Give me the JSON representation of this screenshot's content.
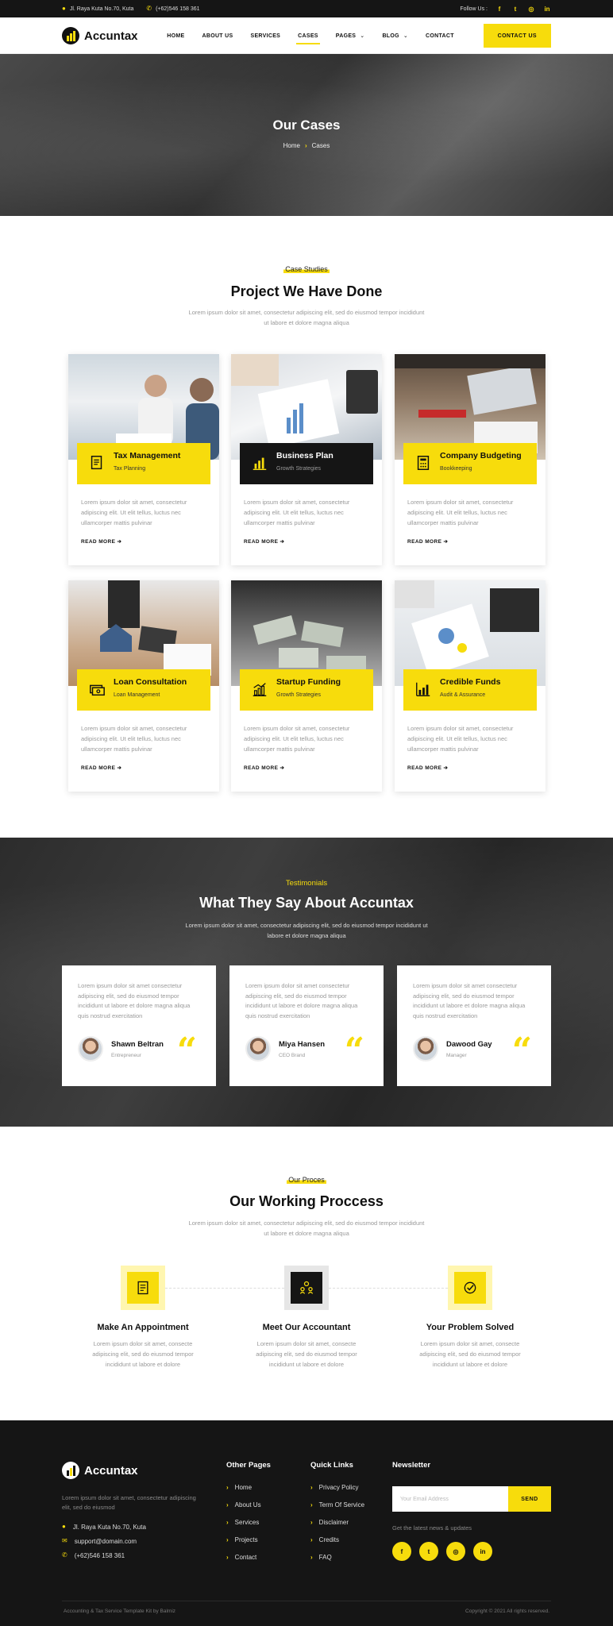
{
  "topbar": {
    "address": "Jl. Raya Kuta No.70, Kuta",
    "phone": "(+62)546 158 361",
    "follow_label": "Follow Us :",
    "socials": [
      "f",
      "t",
      "ig",
      "in"
    ]
  },
  "nav": {
    "brand": "Accuntax",
    "items": [
      "HOME",
      "ABOUT US",
      "SERVICES",
      "CASES",
      "PAGES",
      "BLOG",
      "CONTACT"
    ],
    "active": "CASES",
    "cta": "CONTACT US"
  },
  "hero": {
    "title": "Our Cases",
    "crumb_home": "Home",
    "crumb_current": "Cases"
  },
  "cases": {
    "tag": "Case Studies",
    "title": "Project We Have Done",
    "desc": "Lorem ipsum dolor sit amet, consectetur adipiscing elit, sed do eiusmod tempor incididunt ut labore et dolore magna aliqua",
    "read_more": "READ MORE",
    "items": [
      {
        "title": "Tax Management",
        "subtitle": "Tax Planning",
        "text": "Lorem ipsum dolor sit amet, consectetur adipiscing elit. Ut elit tellus, luctus nec ullamcorper mattis pulvinar",
        "icon": "document-icon"
      },
      {
        "title": "Business Plan",
        "subtitle": "Growth Strategies",
        "text": "Lorem ipsum dolor sit amet, consectetur adipiscing elit. Ut elit tellus, luctus nec ullamcorper mattis pulvinar",
        "icon": "bar-chart-icon"
      },
      {
        "title": "Company Budgeting",
        "subtitle": "Bookkeeping",
        "text": "Lorem ipsum dolor sit amet, consectetur adipiscing elit. Ut elit tellus, luctus nec ullamcorper mattis pulvinar",
        "icon": "calculator-icon"
      },
      {
        "title": "Loan Consultation",
        "subtitle": "Loan Management",
        "text": "Lorem ipsum dolor sit amet, consectetur adipiscing elit. Ut elit tellus, luctus nec ullamcorper mattis pulvinar",
        "icon": "money-icon"
      },
      {
        "title": "Startup Funding",
        "subtitle": "Growth Strategies",
        "text": "Lorem ipsum dolor sit amet, consectetur adipiscing elit. Ut elit tellus, luctus nec ullamcorper mattis pulvinar",
        "icon": "growth-chart-icon"
      },
      {
        "title": "Credible Funds",
        "subtitle": "Audit & Assurance",
        "text": "Lorem ipsum dolor sit amet, consectetur adipiscing elit. Ut elit tellus, luctus nec ullamcorper mattis pulvinar",
        "icon": "analytics-icon"
      }
    ]
  },
  "testimonials": {
    "tag": "Testimonials",
    "title": "What They Say About Accuntax",
    "desc": "Lorem ipsum dolor sit amet, consectetur adipiscing elit, sed do eiusmod tempor incididunt ut labore et dolore magna aliqua",
    "items": [
      {
        "text": "Lorem ipsum dolor sit amet consectetur adipiscing elit, sed do eiusmod tempor incididunt ut labore et dolore magna aliqua quis nostrud exercitation",
        "name": "Shawn Beltran",
        "role": "Entrepreneur"
      },
      {
        "text": "Lorem ipsum dolor sit amet consectetur adipiscing elit, sed do eiusmod tempor incididunt ut labore et dolore magna aliqua quis nostrud exercitation",
        "name": "Miya Hansen",
        "role": "CEO Brand"
      },
      {
        "text": "Lorem ipsum dolor sit amet consectetur adipiscing elit, sed do eiusmod tempor incididunt ut labore et dolore magna aliqua quis nostrud exercitation",
        "name": "Dawood Gay",
        "role": "Manager"
      }
    ]
  },
  "process": {
    "tag": "Our Proces",
    "title": "Our Working Proccess",
    "desc": "Lorem ipsum dolor sit amet, consectetur adipiscing elit, sed do eiusmod tempor incididunt ut labore et dolore magna aliqua",
    "steps": [
      {
        "title": "Make An Appointment",
        "text": "Lorem ipsum dolor sit amet, consecte adipiscing elit, sed do eiusmod tempor incididunt ut labore et dolore"
      },
      {
        "title": "Meet Our Accountant",
        "text": "Lorem ipsum dolor sit amet, consecte adipiscing elit, sed do eiusmod tempor incididunt ut labore et dolore"
      },
      {
        "title": "Your Problem Solved",
        "text": "Lorem ipsum dolor sit amet, consecte adipiscing elit, sed do eiusmod tempor incididunt ut labore et dolore"
      }
    ]
  },
  "footer": {
    "brand": "Accuntax",
    "about": "Lorem ipsum dolor sit amet, consectetur adipiscing elit, sed do eiusmod",
    "address": "Jl. Raya Kuta No.70, Kuta",
    "email": "support@domain.com",
    "phone": "(+62)546 158 361",
    "other_pages_title": "Other Pages",
    "other_pages": [
      "Home",
      "About Us",
      "Services",
      "Projects",
      "Contact"
    ],
    "quick_links_title": "Quick Links",
    "quick_links": [
      "Privacy Policy",
      "Term Of Service",
      "Disclaimer",
      "Credits",
      "FAQ"
    ],
    "newsletter_title": "Newsletter",
    "email_placeholder": "Your Email Address",
    "send": "SEND",
    "note": "Get the latest news & updates",
    "credit": "Accounting & Tax Service Template Kit by Balmiz",
    "copyright": "Copyright © 2021 All rights reserved."
  },
  "colors": {
    "accent": "#f7dc0c",
    "dark": "#151515"
  }
}
